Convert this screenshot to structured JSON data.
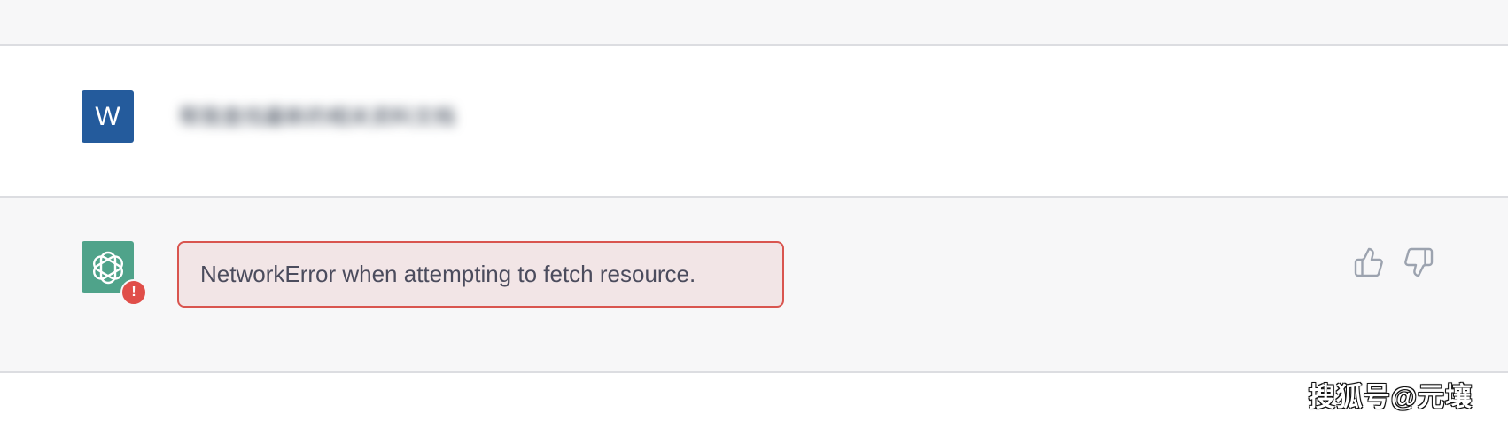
{
  "user_message": {
    "avatar_letter": "W",
    "avatar_color": "#245b9c",
    "text": "帮我查找最新的相关资料文档"
  },
  "assistant_message": {
    "avatar_icon": "openai-logo-icon",
    "avatar_color": "#4fa38a",
    "error_badge": "!",
    "error_badge_color": "#e04e49",
    "error_text": "NetworkError when attempting to fetch resource.",
    "error_border_color": "#d9554f",
    "error_bg_color": "#f2e5e6"
  },
  "feedback": {
    "thumbs_up_icon": "thumbs-up-icon",
    "thumbs_down_icon": "thumbs-down-icon"
  },
  "watermark": {
    "text": "搜狐号@元壤"
  }
}
